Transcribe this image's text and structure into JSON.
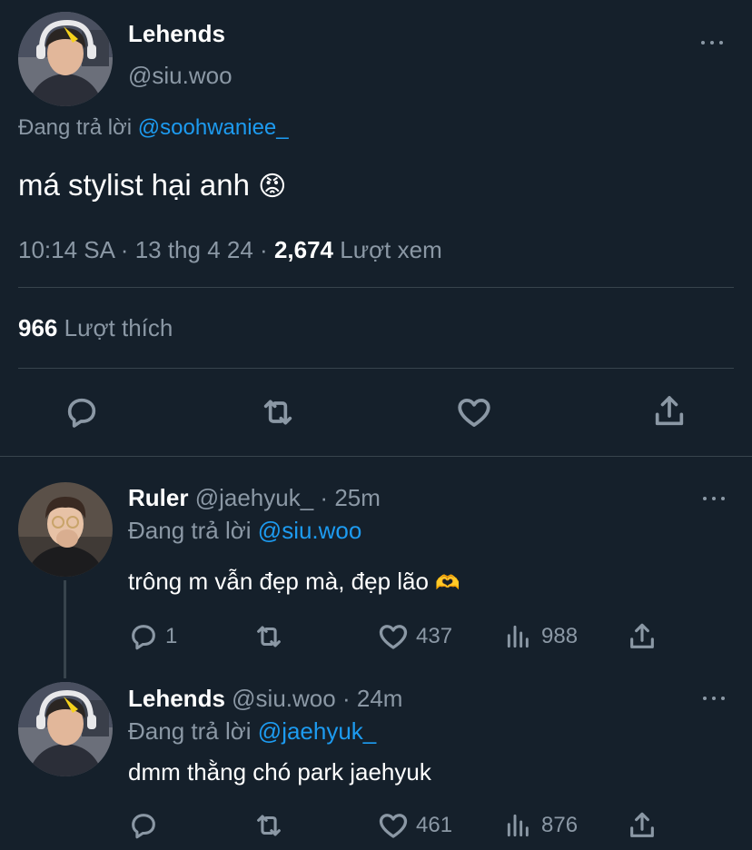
{
  "main_tweet": {
    "author_name": "Lehends",
    "handle": "@siu.woo",
    "replying_prefix": "Đang trả lời",
    "replying_to": "@soohwaniee_",
    "text": "má stylist hại anh",
    "emoji": "😡",
    "time": "10:14 SA",
    "date": "13 thg 4 24",
    "views_count": "2,674",
    "views_label": "Lượt xem",
    "likes_count": "966",
    "likes_label": "Lượt thích"
  },
  "replies": [
    {
      "author_name": "Ruler",
      "handle": "@jaehyuk_",
      "time": "25m",
      "replying_prefix": "Đang trả lời",
      "replying_to": "@siu.woo",
      "text": "trông m vẫn đẹp mà, đẹp lão",
      "emoji": "🫶",
      "replies": "1",
      "likes": "437",
      "views": "988"
    },
    {
      "author_name": "Lehends",
      "handle": "@siu.woo",
      "time": "24m",
      "replying_prefix": "Đang trả lời",
      "replying_to": "@jaehyuk_",
      "text": "dmm thằng chó park jaehyuk",
      "likes": "461",
      "views": "876"
    }
  ],
  "separator": "·",
  "colors": {
    "background": "#15202b",
    "text": "#ffffff",
    "muted": "#8b98a5",
    "link": "#1d9bf0",
    "divider": "#38444d"
  },
  "icons": [
    "more-icon",
    "reply-icon",
    "retweet-icon",
    "like-icon",
    "share-icon",
    "views-icon"
  ]
}
